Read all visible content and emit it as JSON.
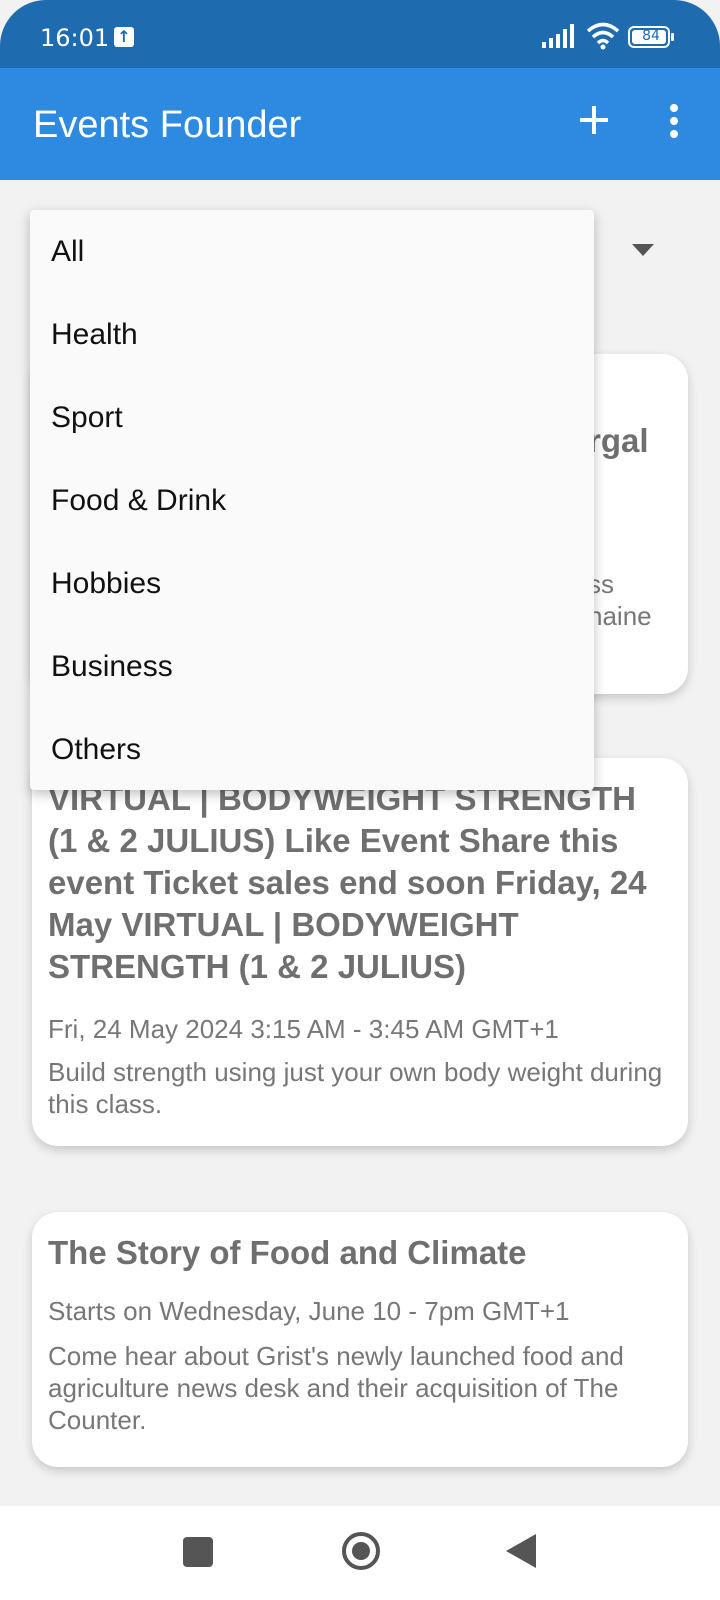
{
  "status_bar": {
    "time": "16:01",
    "battery": "84",
    "upload_badge": "↑"
  },
  "app_bar": {
    "title": "Events Founder",
    "add_icon": "plus-icon",
    "menu_icon": "more-vertical-icon"
  },
  "filter": {
    "options": [
      "All",
      "Health",
      "Sport",
      "Food & Drink",
      "Hobbies",
      "Business",
      "Others"
    ]
  },
  "events": [
    {
      "title_partial": "rgal",
      "desc_partial_1": "ss",
      "desc_partial_2": "naine"
    },
    {
      "title": " VIRTUAL | BODYWEIGHT STRENGTH (1 & 2 JULIUS)  Like Event  Share this event Ticket sales end soon Friday, 24 May VIRTUAL | BODYWEIGHT STRENGTH (1 & 2 JULIUS)",
      "date": "Fri, 24 May 2024 3:15 AM - 3:45 AM GMT+1",
      "description": "Build strength using just your own body weight during this class."
    },
    {
      "title": "The Story of Food and Climate",
      "date": "Starts on Wednesday, June 10 - 7pm GMT+1",
      "description": "Come hear about Grist's newly launched food and agriculture news desk and their acquisition of The Counter."
    }
  ],
  "nav": {
    "recents_icon": "square-icon",
    "home_icon": "circle-icon",
    "back_icon": "triangle-back-icon"
  },
  "colors": {
    "status_bar": "#1e6bb0",
    "app_bar": "#2d8ae0",
    "background": "#f2f2f2"
  }
}
